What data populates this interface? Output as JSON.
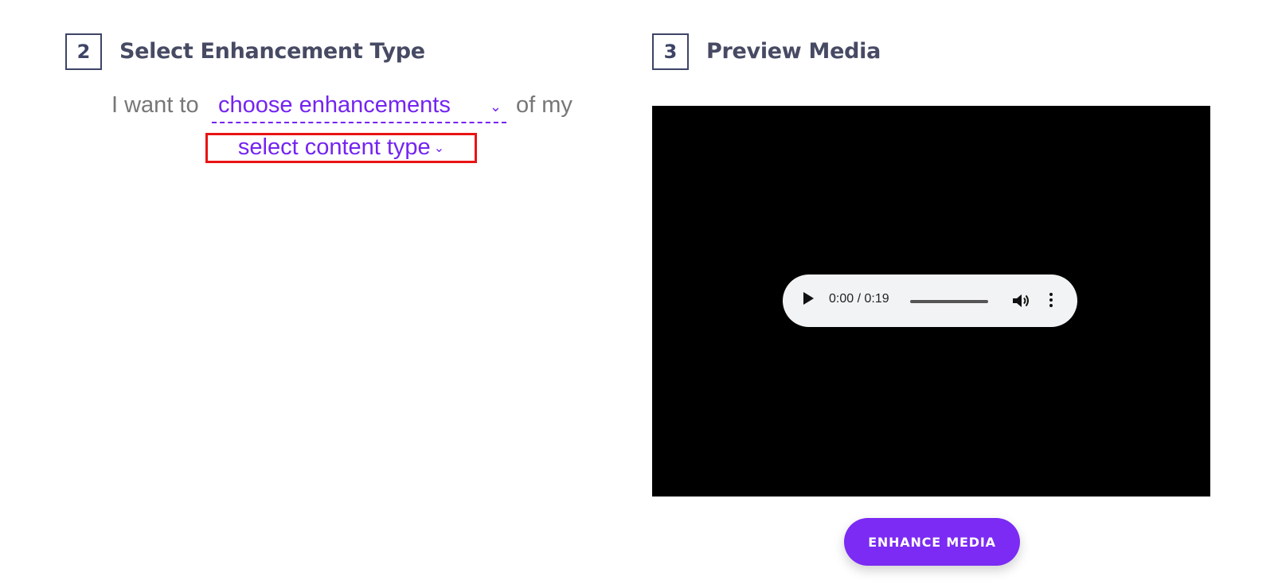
{
  "colors": {
    "accent": "#7424f0",
    "button_bg": "#7b2bf3",
    "highlight_border": "#ea1313",
    "preview_bg": "#000000",
    "step_border": "#3d4466"
  },
  "step2": {
    "number": "2",
    "title": "Select Enhancement Type"
  },
  "step3": {
    "number": "3",
    "title": "Preview Media"
  },
  "sentence": {
    "prefix": "I want to",
    "enhancement_select": "choose enhancements",
    "suffix": "of my",
    "content_select": "select content type"
  },
  "icons": {
    "dropdown": "chevron-down-icon",
    "play": "play-icon",
    "volume": "volume-icon",
    "more": "more-vert-icon"
  },
  "audio": {
    "time": "0:00 / 0:19",
    "progress": 0
  },
  "actions": {
    "enhance_label": "ENHANCE MEDIA"
  }
}
